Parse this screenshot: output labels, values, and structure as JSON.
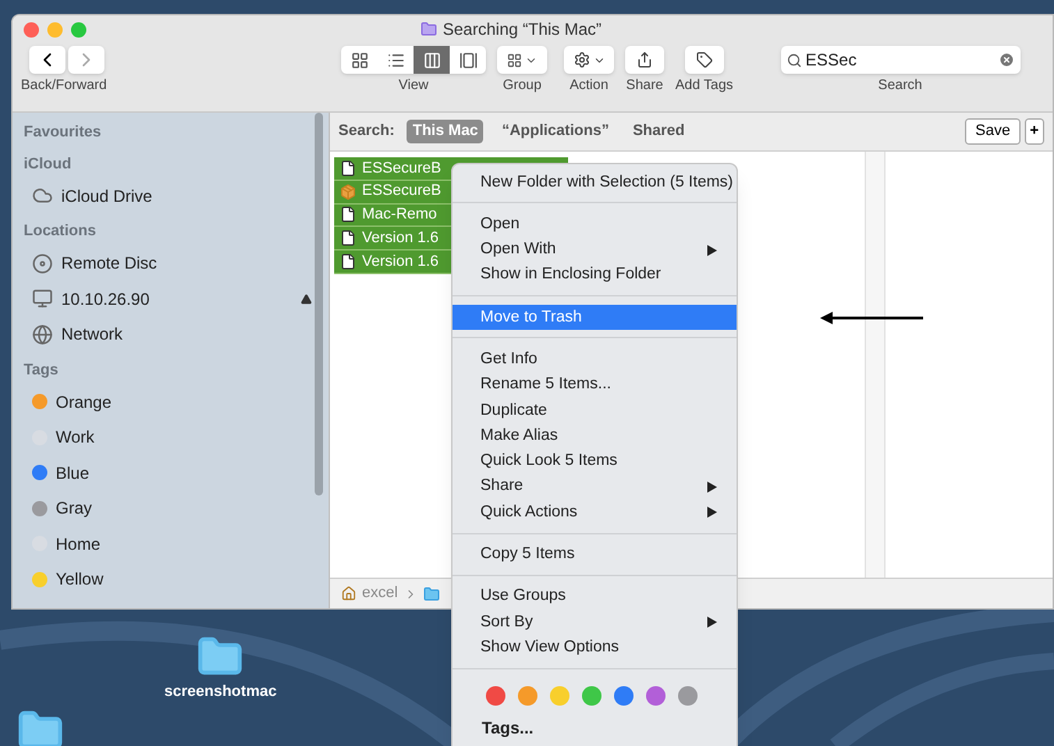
{
  "window": {
    "title": "Searching “This Mac”"
  },
  "toolbar": {
    "nav_label": "Back/Forward",
    "view_label": "View",
    "view_modes": [
      {
        "kind": "icons",
        "selected": false
      },
      {
        "kind": "list",
        "selected": false
      },
      {
        "kind": "columns",
        "selected": true
      },
      {
        "kind": "gallery",
        "selected": false
      }
    ],
    "group_label": "Group",
    "action_label": "Action",
    "share_label": "Share",
    "tags_label": "Add Tags",
    "search": {
      "value": "ESSec",
      "label": "Search"
    }
  },
  "sidebar": {
    "sections": [
      {
        "title": "Favourites"
      },
      {
        "title": "iCloud",
        "items": [
          {
            "kind": "cloud",
            "label": "iCloud Drive",
            "ejectable": false
          }
        ]
      },
      {
        "title": "Locations",
        "items": [
          {
            "kind": "disc",
            "label": "Remote Disc",
            "ejectable": false
          },
          {
            "kind": "monitor",
            "label": "10.10.26.90",
            "ejectable": true
          },
          {
            "kind": "globe",
            "label": "Network",
            "ejectable": false
          }
        ]
      },
      {
        "title": "Tags",
        "items": [
          {
            "kind": "tag",
            "label": "Orange",
            "color": "#f59a2a"
          },
          {
            "kind": "tag",
            "label": "Work",
            "color": "#d8dce2"
          },
          {
            "kind": "tag",
            "label": "Blue",
            "color": "#2f7cf6"
          },
          {
            "kind": "tag",
            "label": "Gray",
            "color": "#9a9a9e"
          },
          {
            "kind": "tag",
            "label": "Home",
            "color": "#d8dce2"
          },
          {
            "kind": "tag",
            "label": "Yellow",
            "color": "#f8cf2c"
          }
        ]
      }
    ]
  },
  "scope_bar": {
    "label": "Search:",
    "scopes": [
      {
        "label": "This Mac",
        "selected": true
      },
      {
        "label": "“Applications”",
        "selected": false
      },
      {
        "label": "Shared",
        "selected": false
      }
    ],
    "save": "Save",
    "add": "+"
  },
  "files": [
    {
      "kind": "document",
      "name": "ESSecureB",
      "selected": true
    },
    {
      "kind": "package",
      "name": "ESSecureB",
      "selected": true
    },
    {
      "kind": "document",
      "name": "Mac-Remo",
      "selected": true
    },
    {
      "kind": "document",
      "name": "Version 1.6",
      "selected": true
    },
    {
      "kind": "document",
      "name": "Version 1.6",
      "selected": true
    }
  ],
  "path_bar": {
    "items": [
      "excel"
    ]
  },
  "context_menu": {
    "sections": [
      [
        {
          "label": "New Folder with Selection (5 Items)",
          "submenu": false,
          "selected": false
        }
      ],
      [
        {
          "label": "Open",
          "submenu": false,
          "selected": false
        },
        {
          "label": "Open With",
          "submenu": true,
          "selected": false
        },
        {
          "label": "Show in Enclosing Folder",
          "submenu": false,
          "selected": false
        }
      ],
      [
        {
          "label": "Move to Trash",
          "submenu": false,
          "selected": true
        }
      ],
      [
        {
          "label": "Get Info",
          "submenu": false,
          "selected": false
        },
        {
          "label": "Rename 5 Items...",
          "submenu": false,
          "selected": false
        },
        {
          "label": "Duplicate",
          "submenu": false,
          "selected": false
        },
        {
          "label": "Make Alias",
          "submenu": false,
          "selected": false
        },
        {
          "label": "Quick Look 5 Items",
          "submenu": false,
          "selected": false
        },
        {
          "label": "Share",
          "submenu": true,
          "selected": false
        },
        {
          "label": "Quick Actions",
          "submenu": true,
          "selected": false
        }
      ],
      [
        {
          "label": "Copy 5 Items",
          "submenu": false,
          "selected": false
        }
      ],
      [
        {
          "label": "Use Groups",
          "submenu": false,
          "selected": false
        },
        {
          "label": "Sort By",
          "submenu": true,
          "selected": false
        },
        {
          "label": "Show View Options",
          "submenu": false,
          "selected": false
        }
      ]
    ],
    "tag_colors": [
      {
        "color": "#f04a45"
      },
      {
        "color": "#f59a2a"
      },
      {
        "color": "#f8cf2c"
      },
      {
        "color": "#3fc748"
      },
      {
        "color": "#2f7cf6"
      },
      {
        "color": "#b25fd8"
      },
      {
        "color": "#9a9a9e"
      }
    ],
    "tags_item": "Tags..."
  },
  "desktop": {
    "folders": [
      {
        "label": "screenshotmac"
      }
    ]
  }
}
